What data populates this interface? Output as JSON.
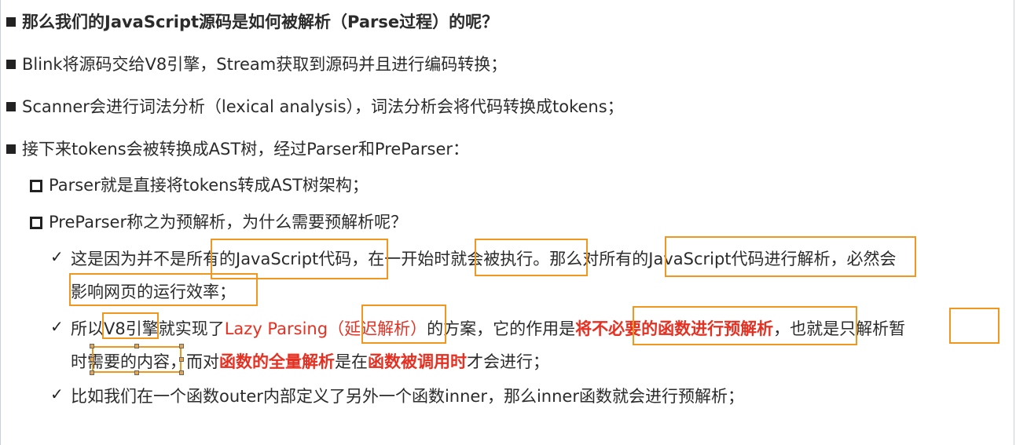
{
  "lines": {
    "l1": "那么我们的JavaScript源码是如何被解析（Parse过程）的呢？",
    "l2": "Blink将源码交给V8引擎，Stream获取到源码并且进行编码转换；",
    "l3": "Scanner会进行词法分析（lexical analysis），词法分析会将代码转换成tokens；",
    "l4": "接下来tokens会被转换成AST树，经过Parser和PreParser：",
    "l5": "Parser就是直接将tokens转成AST树架构；",
    "l6": "PreParser称之为预解析，为什么需要预解析呢？",
    "l7": "这是因为并不是所有的JavaScript代码，在一开始时就会被执行。那么对所有的JavaScript代码进行解析，必然会",
    "l8": "影响网页的运行效率；",
    "l9a": "所以V8引擎就实现了",
    "l9b": "Lazy Parsing（延迟解析）",
    "l9c": "的方案，它的作用是",
    "l9d": "将不必要的函数进行预解析",
    "l9e": "，也就是只解析暂",
    "l10a": "时需要的内容，而对",
    "l10b": "函数的全量解析",
    "l10c": "是在",
    "l10d": "函数被调用时",
    "l10e": "才会进行；",
    "l11": "比如我们在一个函数outer内部定义了另外一个函数inner，那么inner函数就会进行预解析；"
  },
  "check_glyph": "✓",
  "colors": {
    "highlight_box": "#f0971f",
    "emphasis_red": "#e53022"
  }
}
